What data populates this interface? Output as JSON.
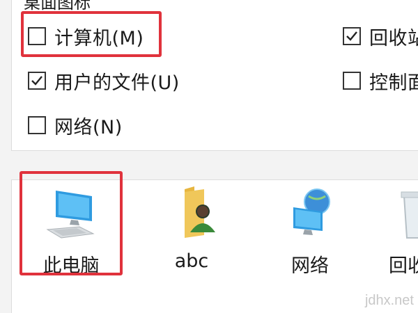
{
  "desktop_icons_group": {
    "title_partial": "桌面图标",
    "checkboxes": [
      {
        "label": "计算机(M)",
        "checked": false
      },
      {
        "label": "用户的文件(U)",
        "checked": true
      },
      {
        "label": "网络(N)",
        "checked": false
      },
      {
        "label": "回收站",
        "checked": true
      },
      {
        "label": "控制面",
        "checked": false
      }
    ]
  },
  "preview_icons": [
    {
      "label": "此电脑",
      "icon": "computer-icon"
    },
    {
      "label": "abc",
      "icon": "user-folder-icon"
    },
    {
      "label": "网络",
      "icon": "network-icon"
    },
    {
      "label": "回收",
      "icon": "recycle-bin-icon"
    }
  ],
  "watermark": "jdhx.net",
  "colors": {
    "highlight": "#e0323c",
    "panel": "#ffffff",
    "background": "#f3f3f3",
    "monitor": "#2f9be0",
    "folder": "#f0c75a"
  }
}
